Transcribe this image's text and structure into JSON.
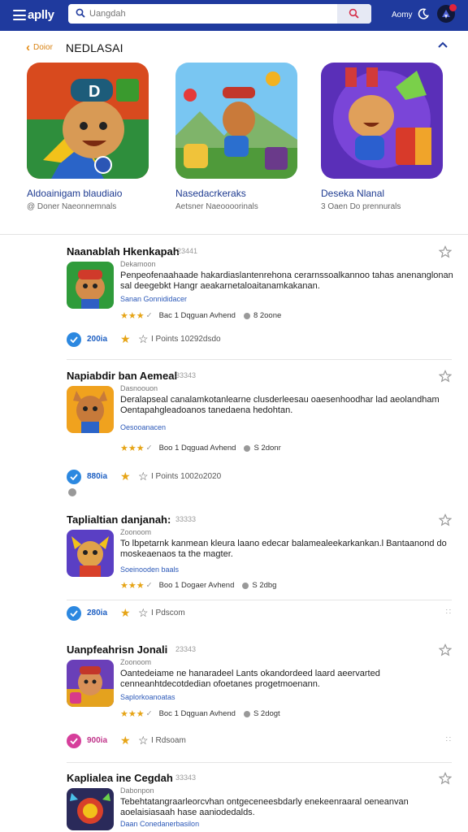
{
  "header": {
    "brand": "aplly",
    "search_placeholder": "Uangdah",
    "link": "Aomy",
    "notif_count": "2"
  },
  "featured": {
    "back_label": "Doior",
    "title": "NEDLASAI",
    "cards": [
      {
        "name": "Aldoainigam blaudiaio",
        "sub": "@ Doner Naeonnemnals"
      },
      {
        "name": "Nasedacrkeraks",
        "sub": "Aetsner Naeoooorinals"
      },
      {
        "name": "Deseka Nlanal",
        "sub": "3 Oaen Do prennurals"
      }
    ]
  },
  "items": [
    {
      "title": "Naanablah Hkenkapah",
      "num": "23441",
      "developer": "Dekamoon",
      "description": "Penpeofenaahaade hakardiaslantenrehona cerarnssoalkannoo tahas anenanglonan sal deegebkt Hangr aeakarnetaloaitanamkakanan.",
      "more": "Sanan Gonnididacer",
      "rating_text": "Bac 1 Dqguan Avhend",
      "extra": "8 2oone",
      "points": "200ia",
      "points_text": "I Points 10292dsdo"
    },
    {
      "title": "Napiabdir ban Aemeal",
      "num": "33343",
      "developer": "Dasnoouon",
      "description": "Deralapseal canalamkotanlearne clusderleesau oaesenhoodhar lad aeolandham Oentapahgleadoanos tanedaena hedohtan.",
      "more": "Oesooanacen",
      "rating_text": "Boo 1 Dqguad Avhend",
      "extra": "S 2donr",
      "points": "880ia",
      "points_text": "I Points 1002o2020"
    },
    {
      "title": "Taplialtian danjanah:",
      "num": "33333",
      "developer": "Zoonoom",
      "description": "To lbpetarnk kanmean kleura laano edecar balamealeekarkankan.l Bantaanond do moskeaenaos ta the magter.",
      "more": "Soeinooden baals",
      "rating_text": "Boo 1 Dogaer Avhend",
      "extra": "S 2dbg",
      "points": "280ia",
      "points_text": "I Pdscom"
    },
    {
      "title": "Uanpfeahrisn Jonali",
      "num": "23343",
      "developer": "Zoonoom",
      "description": "Oantedeiame ne hanaradeel Lants okandordeed laard aeervarted cenneanhtdecotdedian ofoetanes progetmoenann.",
      "more": "Saplorkoanoatas",
      "rating_text": "Boc 1 Dqguan Avhend",
      "extra": "S 2dogt",
      "points": "900ia",
      "points_text": "I Rdsoam"
    },
    {
      "title": "Kaplialea ine Cegdah",
      "num": "33343",
      "developer": "Dabonpon",
      "description": "Tebehtatangraarleorcvhan ontgeceneesbdarly enekeenraaral oeneanvan aoelaisiasaah hase aaniodedalds.",
      "more": "Daan Conedanerbasilon",
      "rating_text": "",
      "extra": "",
      "points": "",
      "points_text": ""
    }
  ],
  "colors": {
    "topbar": "#1f3a9e",
    "accent_orange": "#e48b14",
    "link_blue": "#2b58b8",
    "star_gold": "#e6a416",
    "badge_blue": "#2c88e0",
    "badge_pink": "#d63e9b"
  }
}
